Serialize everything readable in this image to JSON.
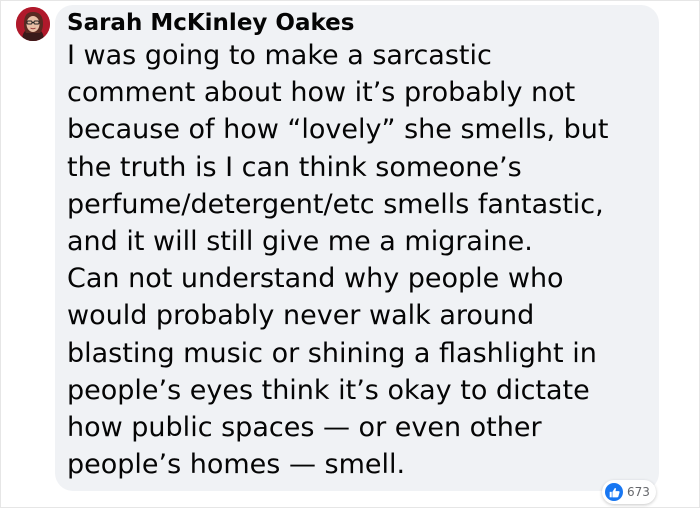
{
  "comment": {
    "author": "Sarah McKinley Oakes",
    "lines": [
      "I was going to make a sarcastic",
      "comment about how it’s probably not",
      "because of how “lovely” she smells, but",
      "the truth is I can think someone’s",
      "perfume/detergent/etc smells fantastic,",
      "and it will still give me a migraine.",
      "Can not understand why people who",
      "would probably never walk around",
      "blasting music or shining a flashlight in",
      "people’s eyes think it’s okay to dictate",
      "how public spaces — or even other",
      "people’s homes — smell."
    ],
    "reactions": {
      "icon": "like-icon",
      "count": "673"
    }
  },
  "colors": {
    "bubble": "#f0f2f5",
    "text": "#050505",
    "like_blue": "#1877f2",
    "count_text": "#65676b"
  }
}
